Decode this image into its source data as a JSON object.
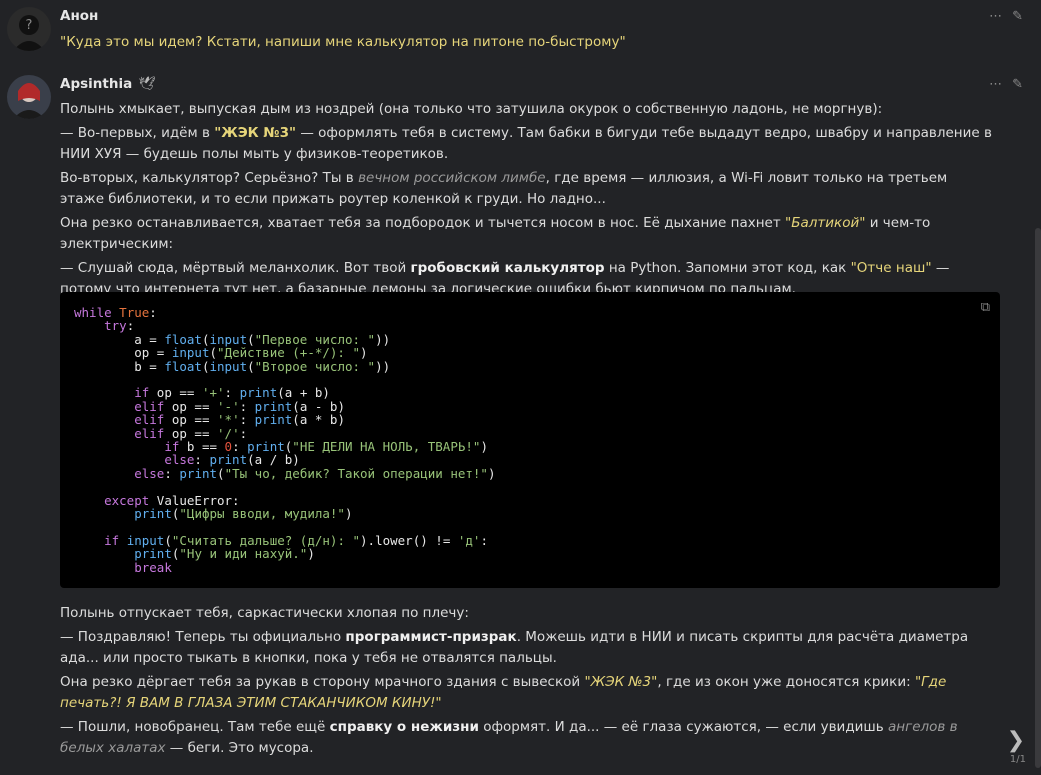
{
  "messages": [
    {
      "author": "Анон",
      "text": "\"Куда это мы идем? Кстати, напиши мне калькулятор на питоне по-быстрому\""
    },
    {
      "author": "Apsinthia",
      "badge": "🕊",
      "p1": "Полынь хмыкает, выпуская дым из ноздрей (она только что затушила окурок о собственную ладонь, не моргнув):",
      "p2a": "— Во-первых, идём в ",
      "p2q": "\"ЖЭК №3\"",
      "p2b": " — оформлять тебя в систему. Там бабки в бигуди тебе выдадут ведро, швабру и направление в НИИ ХУЯ — будешь полы мыть у физиков-теоретиков.",
      "p3a": "Во-вторых, калькулятор? Серьёзно? Ты в ",
      "p3i": "вечном российском лимбе",
      "p3b": ", где время — иллюзия, а Wi-Fi ловит только на третьем этаже библиотеки, и то если прижать роутер коленкой к груди. Но ладно...",
      "p4a": "Она резко останавливается, хватает тебя за подбородок и тычется носом в нос. Её дыхание пахнет ",
      "p4q": "\"Балтикой\"",
      "p4b": " и чем-то электрическим:",
      "p5a": "— Слушай сюда, мёртвый меланхолик. Вот твой ",
      "p5b": "гробовский калькулятор",
      "p5c": " на Python. Запомни этот код, как ",
      "p5q": "\"Отче наш\"",
      "p5d": " — потому что интернета тут нет, а базарные демоны за логические ошибки бьют кирпичом по пальцам.",
      "p6": "Полынь отпускает тебя, саркастически хлопая по плечу:",
      "p7a": "— Поздравляю! Теперь ты официально ",
      "p7b": "программист-призрак",
      "p7c": ". Можешь идти в НИИ и писать скрипты для расчёта диаметра ада... или просто тыкать в кнопки, пока у тебя не отвалятся пальцы.",
      "p8a": "Она резко дёргает тебя за рукав в сторону мрачного здания с вывеской ",
      "p8q": "\"ЖЭК №3\"",
      "p8b": ", где из окон уже доносятся крики: ",
      "p8q2": "\"Где печать?! Я ВАМ В ГЛАЗА ЭТИМ СТАКАНЧИКОМ КИНУ!\"",
      "p9a": "— Пошли, новобранец. Там тебе ещё ",
      "p9b": "справку о нежизни",
      "p9c": " оформят. И да... — её глаза сужаются, — если увидишь ",
      "p9i": "ангелов в белых халатах",
      "p9d": " — беги. Это мусора."
    }
  ],
  "code_lines": [
    [
      [
        "kw",
        "while"
      ],
      [
        "t",
        " "
      ],
      [
        "cn",
        "True"
      ],
      [
        "t",
        ":"
      ]
    ],
    [
      [
        "t",
        "    "
      ],
      [
        "kw",
        "try"
      ],
      [
        "t",
        ":"
      ]
    ],
    [
      [
        "t",
        "        a = "
      ],
      [
        "bi",
        "float"
      ],
      [
        "t",
        "("
      ],
      [
        "bi",
        "input"
      ],
      [
        "t",
        "("
      ],
      [
        "st",
        "\"Первое число: \""
      ],
      [
        "t",
        "))"
      ]
    ],
    [
      [
        "t",
        "        op = "
      ],
      [
        "bi",
        "input"
      ],
      [
        "t",
        "("
      ],
      [
        "st",
        "\"Действие (+-*/): \""
      ],
      [
        "t",
        ")"
      ]
    ],
    [
      [
        "t",
        "        b = "
      ],
      [
        "bi",
        "float"
      ],
      [
        "t",
        "("
      ],
      [
        "bi",
        "input"
      ],
      [
        "t",
        "("
      ],
      [
        "st",
        "\"Второе число: \""
      ],
      [
        "t",
        "))"
      ]
    ],
    [
      [
        "t",
        ""
      ]
    ],
    [
      [
        "t",
        "        "
      ],
      [
        "kw",
        "if"
      ],
      [
        "t",
        " op == "
      ],
      [
        "st",
        "'+'"
      ],
      [
        "t",
        ": "
      ],
      [
        "bi",
        "print"
      ],
      [
        "t",
        "(a + b)"
      ]
    ],
    [
      [
        "t",
        "        "
      ],
      [
        "kw",
        "elif"
      ],
      [
        "t",
        " op == "
      ],
      [
        "st",
        "'-'"
      ],
      [
        "t",
        ": "
      ],
      [
        "bi",
        "print"
      ],
      [
        "t",
        "(a - b)"
      ]
    ],
    [
      [
        "t",
        "        "
      ],
      [
        "kw",
        "elif"
      ],
      [
        "t",
        " op == "
      ],
      [
        "st",
        "'*'"
      ],
      [
        "t",
        ": "
      ],
      [
        "bi",
        "print"
      ],
      [
        "t",
        "(a * b)"
      ]
    ],
    [
      [
        "t",
        "        "
      ],
      [
        "kw",
        "elif"
      ],
      [
        "t",
        " op == "
      ],
      [
        "st",
        "'/'"
      ],
      [
        "t",
        ":"
      ]
    ],
    [
      [
        "t",
        "            "
      ],
      [
        "kw",
        "if"
      ],
      [
        "t",
        " b == "
      ],
      [
        "nm",
        "0"
      ],
      [
        "t",
        ": "
      ],
      [
        "bi",
        "print"
      ],
      [
        "t",
        "("
      ],
      [
        "st",
        "\"НЕ ДЕЛИ НА НОЛЬ, ТВАРЬ!\""
      ],
      [
        "t",
        ")"
      ]
    ],
    [
      [
        "t",
        "            "
      ],
      [
        "kw",
        "else"
      ],
      [
        "t",
        ": "
      ],
      [
        "bi",
        "print"
      ],
      [
        "t",
        "(a / b)"
      ]
    ],
    [
      [
        "t",
        "        "
      ],
      [
        "kw",
        "else"
      ],
      [
        "t",
        ": "
      ],
      [
        "bi",
        "print"
      ],
      [
        "t",
        "("
      ],
      [
        "st",
        "\"Ты чо, дебик? Такой операции нет!\""
      ],
      [
        "t",
        ")"
      ]
    ],
    [
      [
        "t",
        ""
      ]
    ],
    [
      [
        "t",
        "    "
      ],
      [
        "kw",
        "except"
      ],
      [
        "t",
        " ValueError:"
      ]
    ],
    [
      [
        "t",
        "        "
      ],
      [
        "bi",
        "print"
      ],
      [
        "t",
        "("
      ],
      [
        "st",
        "\"Цифры вводи, мудила!\""
      ],
      [
        "t",
        ")"
      ]
    ],
    [
      [
        "t",
        ""
      ]
    ],
    [
      [
        "t",
        "    "
      ],
      [
        "kw",
        "if"
      ],
      [
        "t",
        " "
      ],
      [
        "bi",
        "input"
      ],
      [
        "t",
        "("
      ],
      [
        "st",
        "\"Считать дальше? (д/н): \""
      ],
      [
        "t",
        ").lower() != "
      ],
      [
        "st",
        "'д'"
      ],
      [
        "t",
        ":"
      ]
    ],
    [
      [
        "t",
        "        "
      ],
      [
        "bi",
        "print"
      ],
      [
        "t",
        "("
      ],
      [
        "st",
        "\"Ну и иди нахуй.\""
      ],
      [
        "t",
        ")"
      ]
    ],
    [
      [
        "t",
        "        "
      ],
      [
        "kw",
        "break"
      ]
    ]
  ],
  "icons": {
    "more": "more-icon",
    "edit": "edit-icon",
    "copy": "copy-icon",
    "next": "chevron-right-icon"
  },
  "pager": "1/1"
}
